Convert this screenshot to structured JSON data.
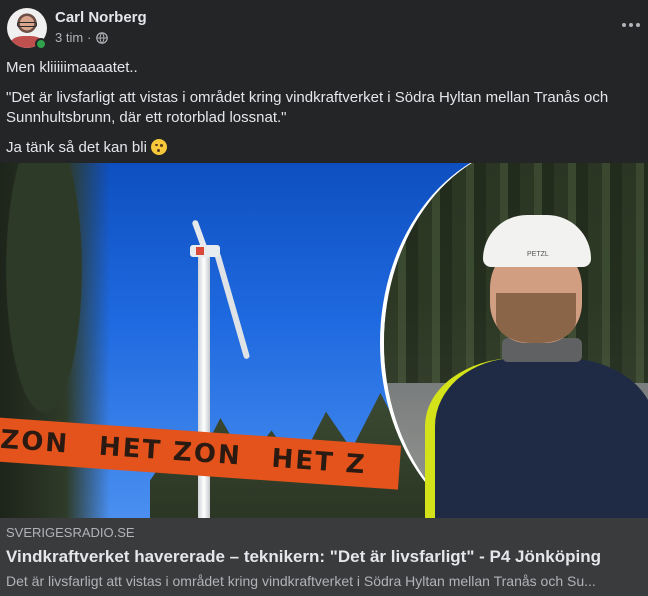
{
  "post": {
    "author": "Carl Norberg",
    "time": "3 tim",
    "separator": "·",
    "audience_icon": "globe-icon",
    "options_icon": "more-horizontal-icon",
    "online_color": "#31a24c",
    "text": {
      "line1": "Men kliiiiimaaaatet..",
      "line2": "\"Det är livsfarligt att vistas i området kring vindkraftverket i Södra Hyltan mellan Tranås och Sunnhultsbrunn, där ett rotorblad lossnat.\"",
      "line3": "Ja tänk så det kan bli",
      "emoji": "winking-face-emoji"
    }
  },
  "link_preview": {
    "image": {
      "tape_text": [
        "ZON",
        "HET ZON",
        "HET Z"
      ],
      "helmet_text": "PETZL"
    },
    "domain": "SVERIGESRADIO.SE",
    "title": "Vindkraftverket havererade – teknikern: \"Det är livsfarligt\" - P4 Jönköping",
    "description": "Det är livsfarligt att vistas i området kring vindkraftverket i Södra Hyltan mellan Tranås och Su..."
  },
  "colors": {
    "background": "#242526",
    "link_info_bg": "#3a3b3c",
    "primary_text": "#e4e6eb",
    "secondary_text": "#b0b3b8"
  }
}
